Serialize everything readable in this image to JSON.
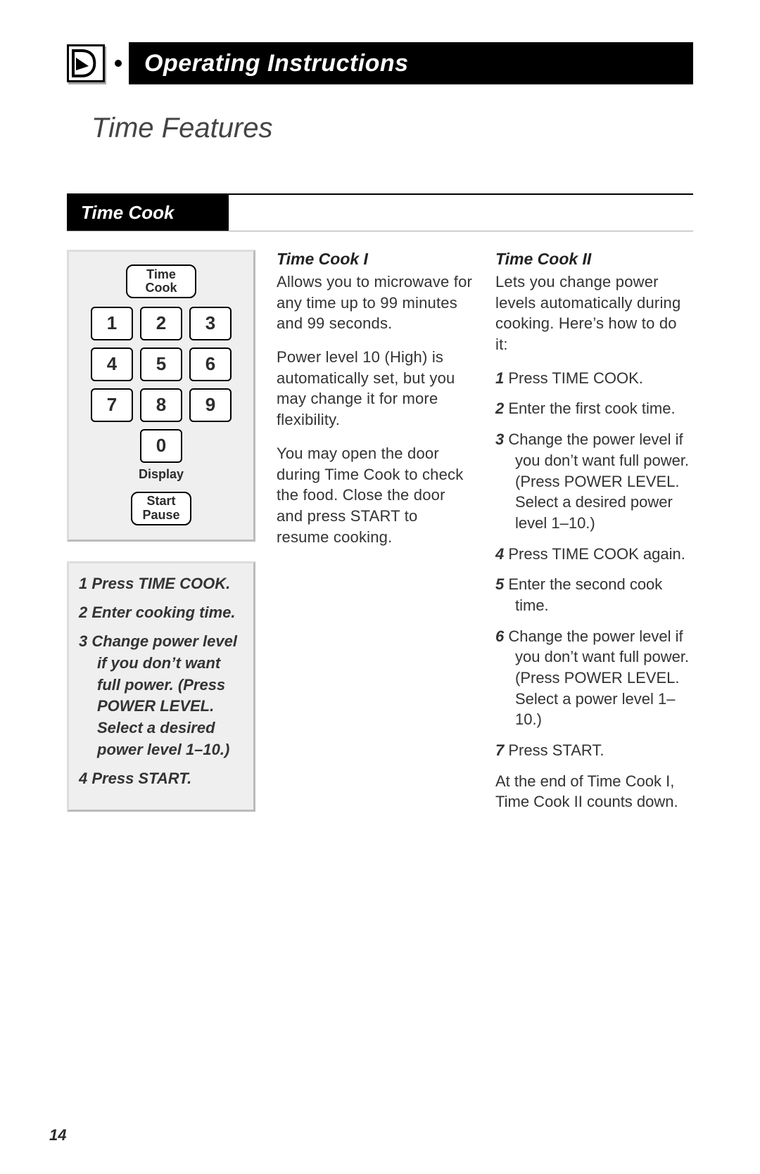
{
  "header": {
    "banner_title": "Operating Instructions"
  },
  "page_title": "Time Features",
  "section_tab": "Time Cook",
  "keypad": {
    "time_cook_btn_l1": "Time",
    "time_cook_btn_l2": "Cook",
    "keys": [
      "1",
      "2",
      "3",
      "4",
      "5",
      "6",
      "7",
      "8",
      "9",
      "0"
    ],
    "display_label": "Display",
    "start_label": "Start",
    "pause_label": "Pause"
  },
  "left_steps": [
    {
      "n": "1",
      "text": "Press TIME COOK."
    },
    {
      "n": "2",
      "text": "Enter cooking time."
    },
    {
      "n": "3",
      "text": "Change power level if you don’t want full power. (Press POWER LEVEL. Select a desired power level 1–10.)"
    },
    {
      "n": "4",
      "text": "Press START."
    }
  ],
  "col_mid": {
    "heading": "Time Cook I",
    "p1": "Allows you to microwave for any time up to 99 minutes and 99 seconds.",
    "p2": "Power level 10 (High) is automatically set, but you may change it for more flexibility.",
    "p3": "You may open the door during Time Cook to check the food. Close the door and press START to resume cooking."
  },
  "col_right": {
    "heading": "Time Cook II",
    "intro": "Lets you change power levels automatically during cooking. Here’s how to do it:",
    "steps": [
      {
        "n": "1",
        "text": "Press TIME COOK."
      },
      {
        "n": "2",
        "text": "Enter the first cook time."
      },
      {
        "n": "3",
        "text": "Change the power level if you don’t want full power. (Press POWER LEVEL. Select a desired power level 1–10.)"
      },
      {
        "n": "4",
        "text": "Press TIME COOK again."
      },
      {
        "n": "5",
        "text": "Enter the second cook time."
      },
      {
        "n": "6",
        "text": "Change the power level if you don’t want full power. (Press POWER LEVEL. Select a power level 1–10.)"
      },
      {
        "n": "7",
        "text": "Press START."
      }
    ],
    "footer_note": "At the end of Time Cook I, Time Cook II counts down."
  },
  "page_number": "14"
}
